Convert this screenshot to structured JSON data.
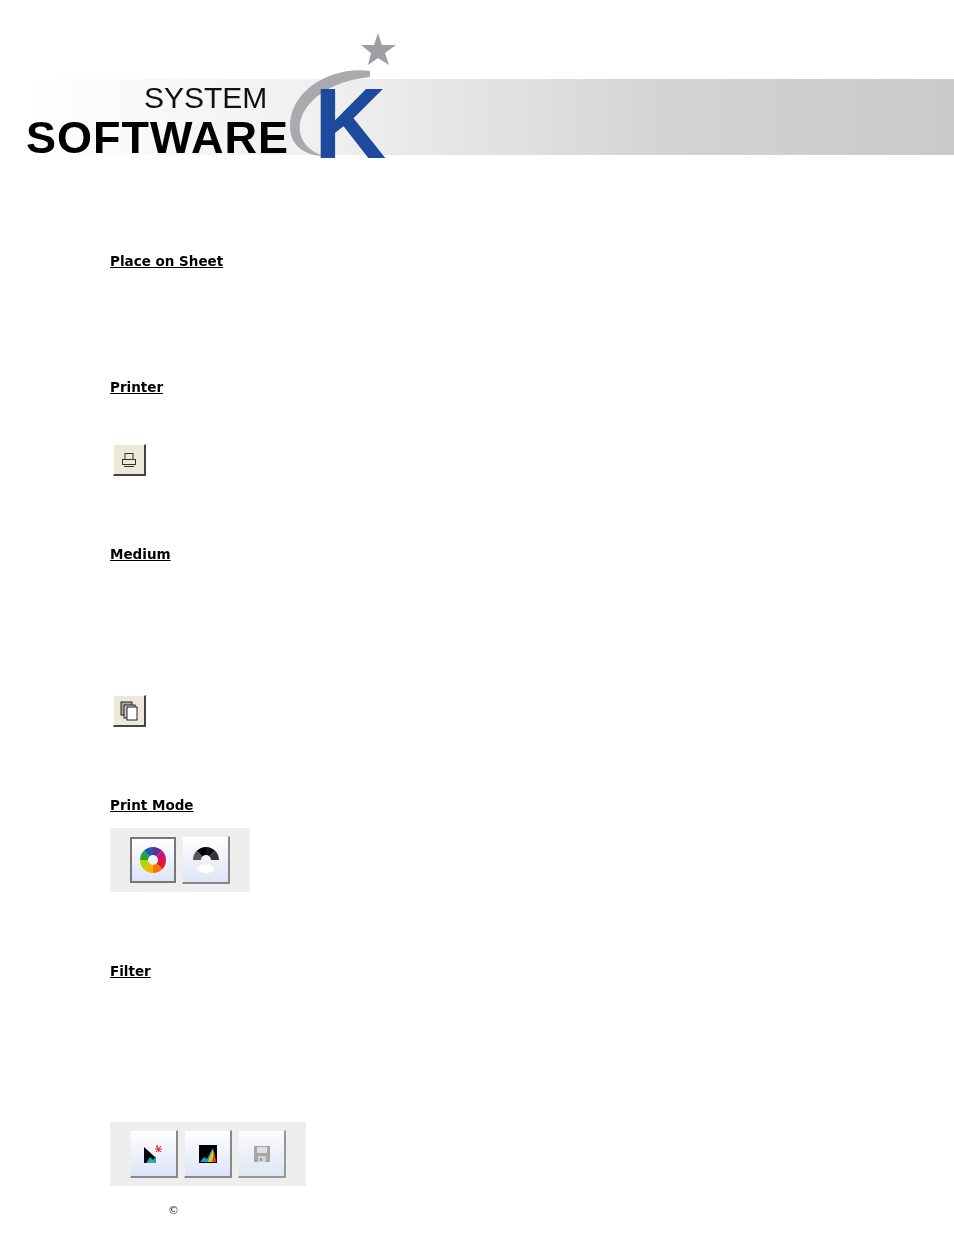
{
  "header": {
    "logo_small": "SYSTEM",
    "logo_large": "SOFTWARE",
    "logo_letter": "K"
  },
  "sections": [
    {
      "heading": "Place on Sheet"
    },
    {
      "heading": "Printer",
      "toolbar": {
        "kind": "classic",
        "buttons": [
          {
            "kind": "printer"
          }
        ]
      }
    },
    {
      "heading": "Medium",
      "toolbar": {
        "kind": "classic",
        "buttons": [
          {
            "kind": "copies"
          }
        ]
      }
    },
    {
      "heading": "Print Mode",
      "toolbar": {
        "kind": "panel",
        "buttons": [
          {
            "kind": "color-wheel",
            "selected": true
          },
          {
            "kind": "gray-wheel",
            "selected": false
          }
        ]
      }
    },
    {
      "heading": "Filter",
      "toolbar": {
        "kind": "panel",
        "buttons": [
          {
            "kind": "histogram-spark",
            "disabled": false
          },
          {
            "kind": "histogram",
            "disabled": false
          },
          {
            "kind": "floppy",
            "disabled": true
          }
        ]
      }
    }
  ],
  "copyright": "©"
}
